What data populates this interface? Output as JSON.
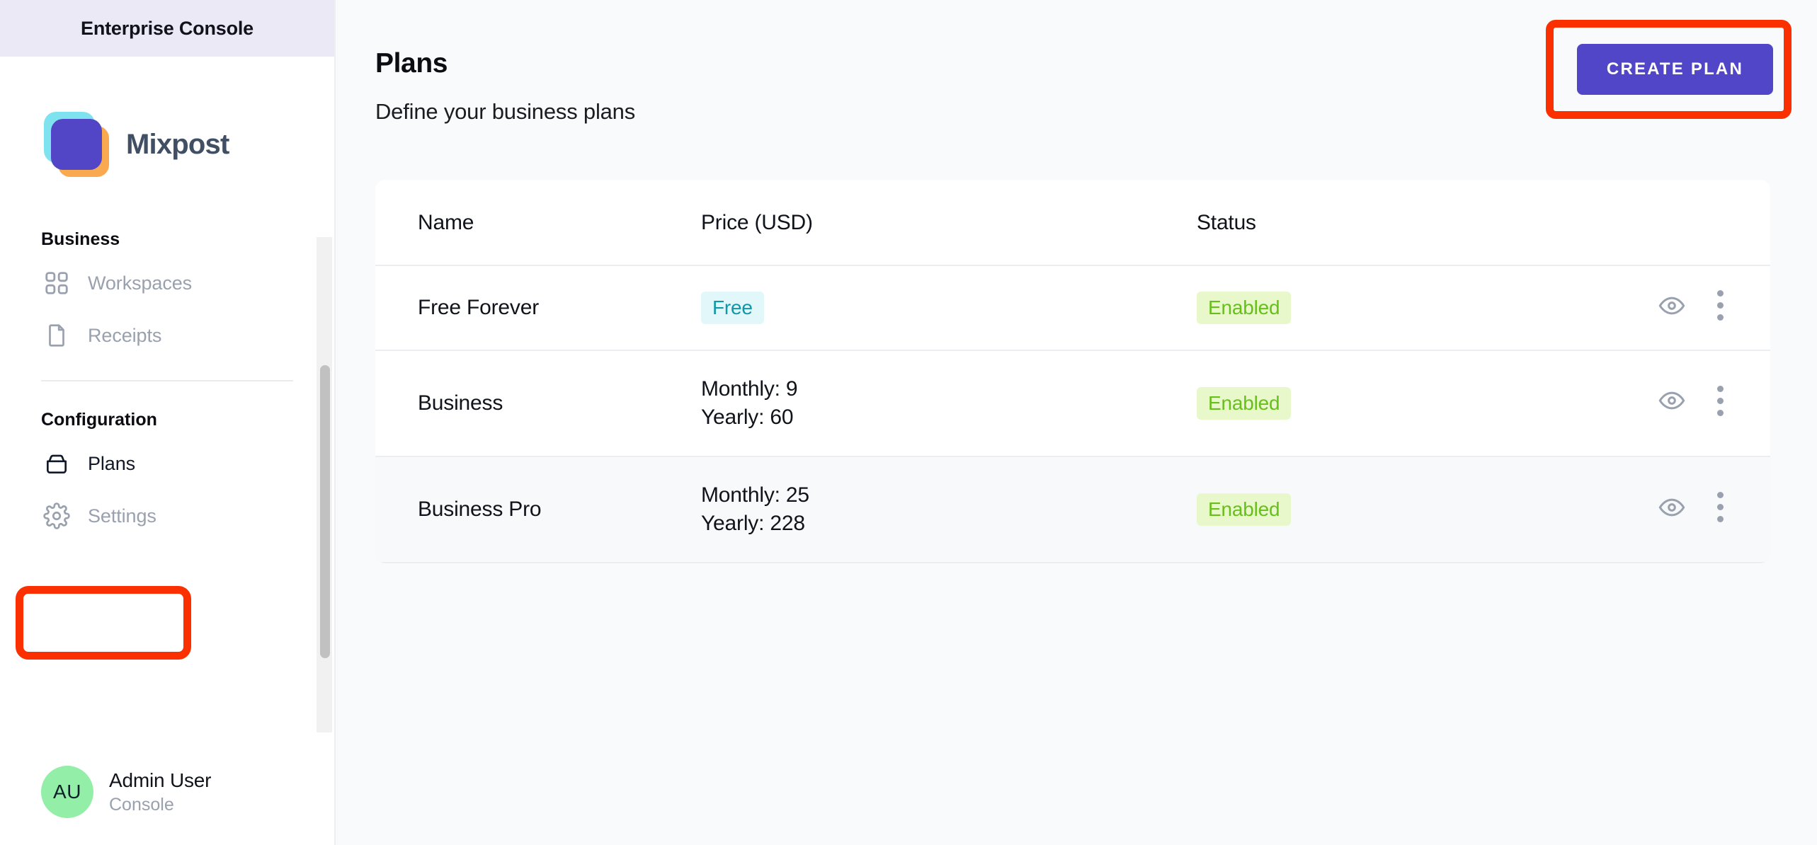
{
  "sidebar": {
    "console_bar_title": "Enterprise Console",
    "brand_name": "Mixpost",
    "sections": [
      {
        "label": "Business"
      },
      {
        "label": "Configuration"
      }
    ],
    "business_items": [
      {
        "label": "Workspaces",
        "icon": "grid-icon"
      },
      {
        "label": "Receipts",
        "icon": "document-icon"
      }
    ],
    "configuration_items": [
      {
        "label": "Plans",
        "icon": "box-icon",
        "active": true
      },
      {
        "label": "Settings",
        "icon": "gear-icon",
        "active": false
      }
    ],
    "user": {
      "initials": "AU",
      "name": "Admin User",
      "subtitle": "Console"
    }
  },
  "main": {
    "title": "Plans",
    "subtitle": "Define your business plans",
    "create_button": "CREATE PLAN"
  },
  "table": {
    "columns": [
      "Name",
      "Price (USD)",
      "Status"
    ],
    "rows": [
      {
        "name": "Free Forever",
        "price_badge": "Free",
        "price_monthly": "",
        "price_yearly": "",
        "status": "Enabled"
      },
      {
        "name": "Business",
        "price_badge": "",
        "price_monthly": "Monthly: 9",
        "price_yearly": "Yearly: 60",
        "status": "Enabled"
      },
      {
        "name": "Business Pro",
        "price_badge": "",
        "price_monthly": "Monthly: 25",
        "price_yearly": "Yearly: 228",
        "status": "Enabled"
      }
    ]
  },
  "colors": {
    "accent_purple": "#5146c8",
    "annotation_red": "#fa3000",
    "badge_free_bg": "#e2f7fa",
    "badge_free_text": "#0d99a8",
    "badge_enabled_bg": "#e9f8cb",
    "badge_enabled_text": "#67bf1b",
    "avatar_green": "#93efa7",
    "console_bar_bg": "#ebe9f6"
  }
}
